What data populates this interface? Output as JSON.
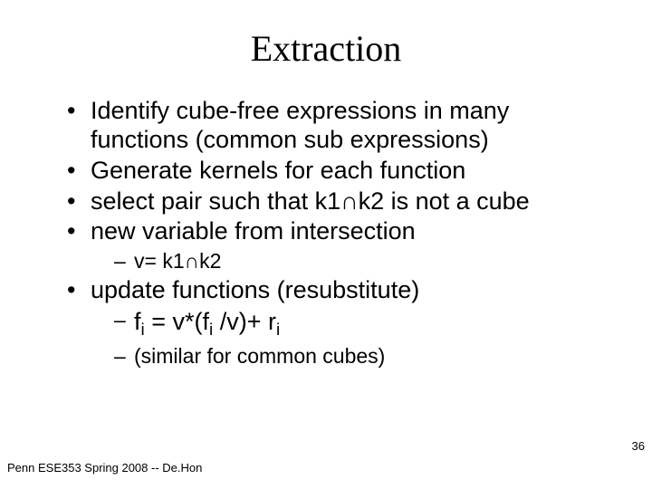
{
  "title": "Extraction",
  "bullets": {
    "b1": "Identify cube-free expressions in many functions (common sub expressions)",
    "b2": "Generate kernels for each function",
    "b3_pre": "select pair such that k1",
    "b3_sym": "∩",
    "b3_post": "k2 is not a cube",
    "b4": "new variable from intersection",
    "b4_sub1_pre": "v= k1",
    "b4_sub1_sym": "∩",
    "b4_sub1_post": "k2",
    "b5": "update functions (resubstitute)",
    "b5_sub1_lhs": "f",
    "b5_sub1_lhs_sub": "i",
    "b5_sub1_mid1": " = v*(f",
    "b5_sub1_mid1_sub": "i",
    "b5_sub1_mid2": " /v)+ r",
    "b5_sub1_mid2_sub": "i",
    "b5_sub2": "(similar for common cubes)"
  },
  "footer": {
    "left": "Penn ESE353 Spring 2008 -- De.Hon",
    "right": "36"
  }
}
